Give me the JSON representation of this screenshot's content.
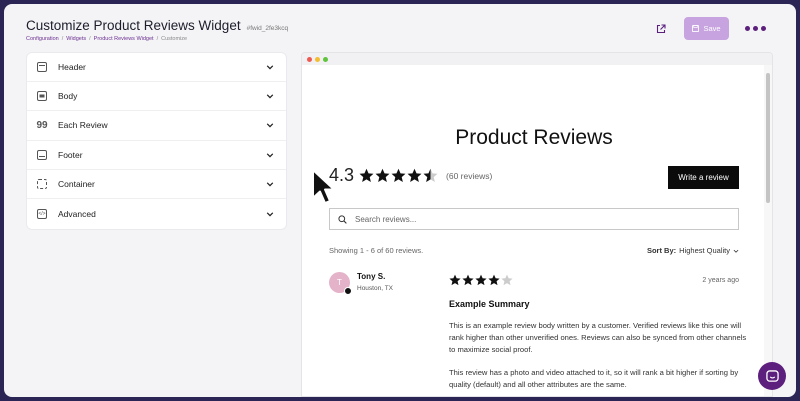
{
  "header": {
    "title": "Customize Product Reviews Widget",
    "widget_id": "#fwid_2fe3kcq",
    "save_label": "Save"
  },
  "breadcrumb": [
    "Configuration",
    "Widgets",
    "Product Reviews Widget",
    "Customize"
  ],
  "sidebar": {
    "items": [
      {
        "label": "Header",
        "icon": "header-icon"
      },
      {
        "label": "Body",
        "icon": "body-icon"
      },
      {
        "label": "Each Review",
        "icon": "quote-icon"
      },
      {
        "label": "Footer",
        "icon": "footer-icon"
      },
      {
        "label": "Container",
        "icon": "container-icon"
      },
      {
        "label": "Advanced",
        "icon": "code-icon"
      }
    ]
  },
  "preview": {
    "title": "Product Reviews",
    "average_rating": "4.3",
    "average_rating_value": 4.3,
    "review_count": "(60 reviews)",
    "write_review_label": "Write a review",
    "search_placeholder": "Search reviews...",
    "showing_text": "Showing 1 - 6 of 60 reviews.",
    "sort_label": "Sort By:",
    "sort_value": "Highest Quality",
    "review": {
      "avatar_initial": "T",
      "name": "Tony S.",
      "location": "Houston, TX",
      "rating": 4,
      "date": "2 years ago",
      "summary": "Example Summary",
      "paragraphs": [
        "This is an example review body written by a customer. Verified reviews like this one will rank higher than other unverified ones. Reviews can also be synced from other channels to maximize social proof.",
        "This review has a photo and video attached to it, so it will rank a bit higher if sorting by quality (default) and all other attributes are the same."
      ]
    }
  },
  "colors": {
    "brand": "#5c1f7d",
    "save_button": "#c7a3df",
    "link": "#6b2f8f",
    "background": "#2a2554"
  }
}
